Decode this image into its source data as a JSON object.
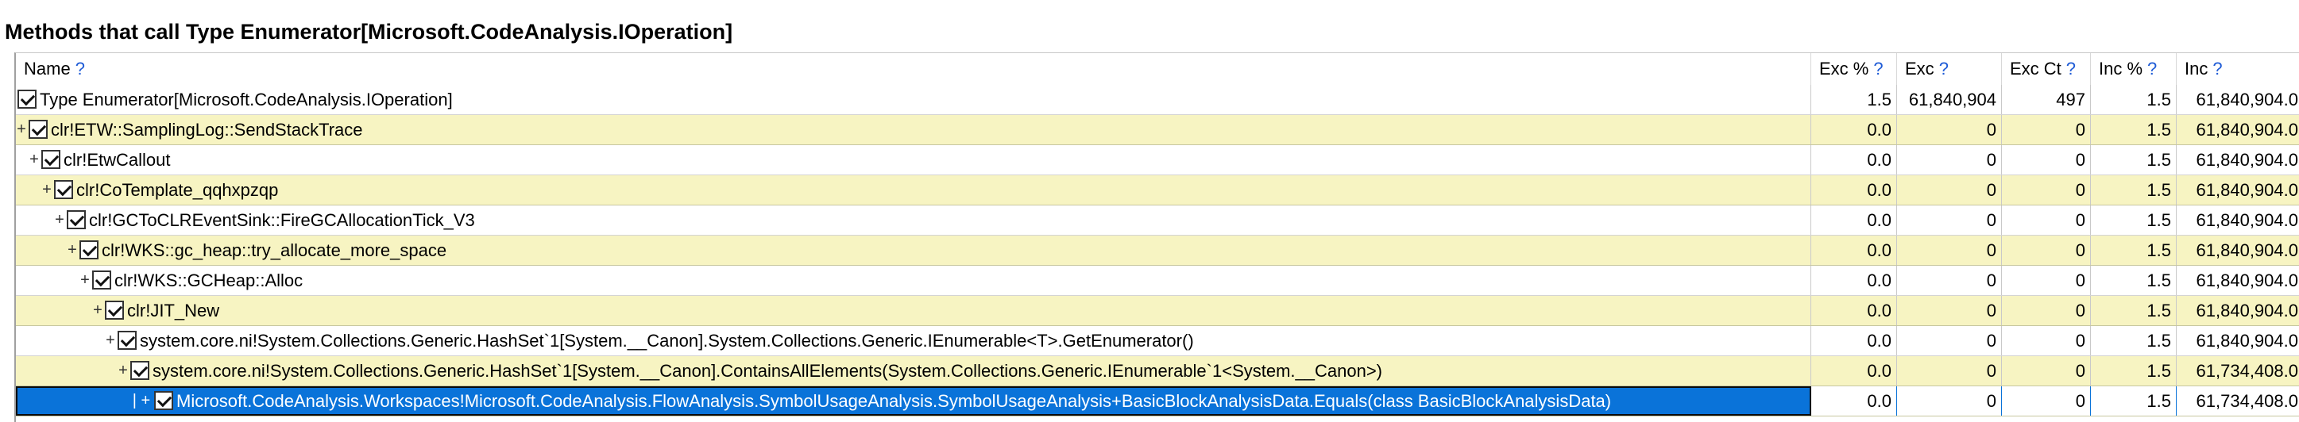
{
  "title": "Methods that call Type Enumerator[Microsoft.CodeAnalysis.IOperation]",
  "help_mark": "?",
  "columns": [
    "Name",
    "Exc %",
    "Exc",
    "Exc Ct",
    "Inc %",
    "Inc"
  ],
  "rows": [
    {
      "expander": "",
      "name": "Type Enumerator[Microsoft.CodeAnalysis.IOperation]",
      "exc_pct": "1.5",
      "exc": "61,840,904",
      "exc_ct": "497",
      "inc_pct": "1.5",
      "inc": "61,840,904.0",
      "style": "white"
    },
    {
      "expander": "+",
      "name": "clr!ETW::SamplingLog::SendStackTrace",
      "exc_pct": "0.0",
      "exc": "0",
      "exc_ct": "0",
      "inc_pct": "1.5",
      "inc": "61,840,904.0",
      "style": "yellow"
    },
    {
      "expander": "+",
      "name": "clr!EtwCallout",
      "exc_pct": "0.0",
      "exc": "0",
      "exc_ct": "0",
      "inc_pct": "1.5",
      "inc": "61,840,904.0",
      "style": "white"
    },
    {
      "expander": "+",
      "name": "clr!CoTemplate_qqhxpzqp",
      "exc_pct": "0.0",
      "exc": "0",
      "exc_ct": "0",
      "inc_pct": "1.5",
      "inc": "61,840,904.0",
      "style": "yellow"
    },
    {
      "expander": "+",
      "name": "clr!GCToCLREventSink::FireGCAllocationTick_V3",
      "exc_pct": "0.0",
      "exc": "0",
      "exc_ct": "0",
      "inc_pct": "1.5",
      "inc": "61,840,904.0",
      "style": "white"
    },
    {
      "expander": "+",
      "name": "clr!WKS::gc_heap::try_allocate_more_space",
      "exc_pct": "0.0",
      "exc": "0",
      "exc_ct": "0",
      "inc_pct": "1.5",
      "inc": "61,840,904.0",
      "style": "yellow"
    },
    {
      "expander": "+",
      "name": "clr!WKS::GCHeap::Alloc",
      "exc_pct": "0.0",
      "exc": "0",
      "exc_ct": "0",
      "inc_pct": "1.5",
      "inc": "61,840,904.0",
      "style": "white"
    },
    {
      "expander": "+",
      "name": "clr!JIT_New",
      "exc_pct": "0.0",
      "exc": "0",
      "exc_ct": "0",
      "inc_pct": "1.5",
      "inc": "61,840,904.0",
      "style": "yellow"
    },
    {
      "expander": "+",
      "name": "system.core.ni!System.Collections.Generic.HashSet`1[System.__Canon].System.Collections.Generic.IEnumerable<T>.GetEnumerator()",
      "exc_pct": "0.0",
      "exc": "0",
      "exc_ct": "0",
      "inc_pct": "1.5",
      "inc": "61,840,904.0",
      "style": "white"
    },
    {
      "expander": "+",
      "name": "system.core.ni!System.Collections.Generic.HashSet`1[System.__Canon].ContainsAllElements(System.Collections.Generic.IEnumerable`1<System.__Canon>)",
      "exc_pct": "0.0",
      "exc": "0",
      "exc_ct": "0",
      "inc_pct": "1.5",
      "inc": "61,734,408.0",
      "style": "yellow"
    },
    {
      "expander": "| +",
      "name": "Microsoft.CodeAnalysis.Workspaces!Microsoft.CodeAnalysis.FlowAnalysis.SymbolUsageAnalysis.SymbolUsageAnalysis+BasicBlockAnalysisData.Equals(class BasicBlockAnalysisData)",
      "exc_pct": "0.0",
      "exc": "0",
      "exc_ct": "0",
      "inc_pct": "1.5",
      "inc": "61,734,408.0",
      "style": "sel"
    }
  ]
}
